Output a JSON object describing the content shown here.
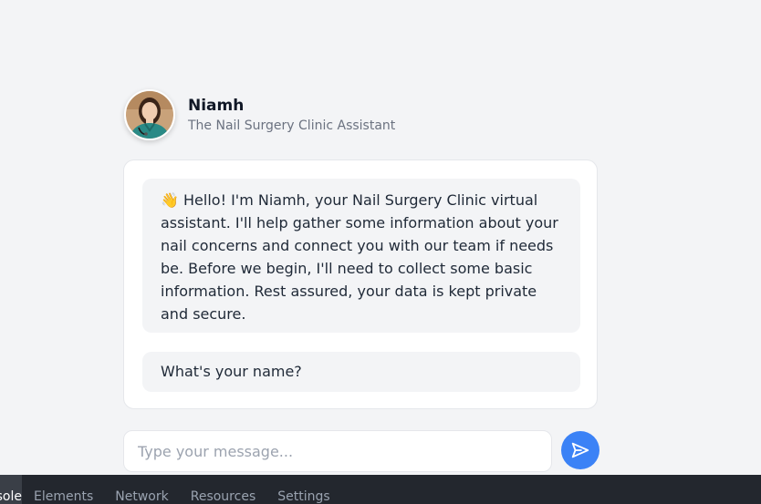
{
  "assistant": {
    "name": "Niamh",
    "subtitle": "The Nail Surgery Clinic Assistant"
  },
  "chat": {
    "messages": [
      {
        "sender": "assistant",
        "icon": "waving-hand-icon",
        "text": "Hello! I'm Niamh, your Nail Surgery Clinic virtual assistant. I'll help gather some information about your nail concerns and connect you with our team if needs be. Before we begin, I'll need to collect some basic information. Rest assured, your data is kept private and secure."
      },
      {
        "sender": "assistant",
        "text": "What's your name?"
      }
    ]
  },
  "composer": {
    "placeholder": "Type your message...",
    "value": "",
    "send_icon": "send-icon"
  },
  "devtools": {
    "tabs": [
      {
        "label": "Console",
        "active": true
      },
      {
        "label": "Elements",
        "active": false
      },
      {
        "label": "Network",
        "active": false
      },
      {
        "label": "Resources",
        "active": false
      },
      {
        "label": "Settings",
        "active": false
      }
    ]
  },
  "colors": {
    "page_background": "#f3f4f6",
    "accent": "#3b82f6",
    "bubble_background": "#f3f4f6",
    "devtools_background": "#23272e"
  }
}
